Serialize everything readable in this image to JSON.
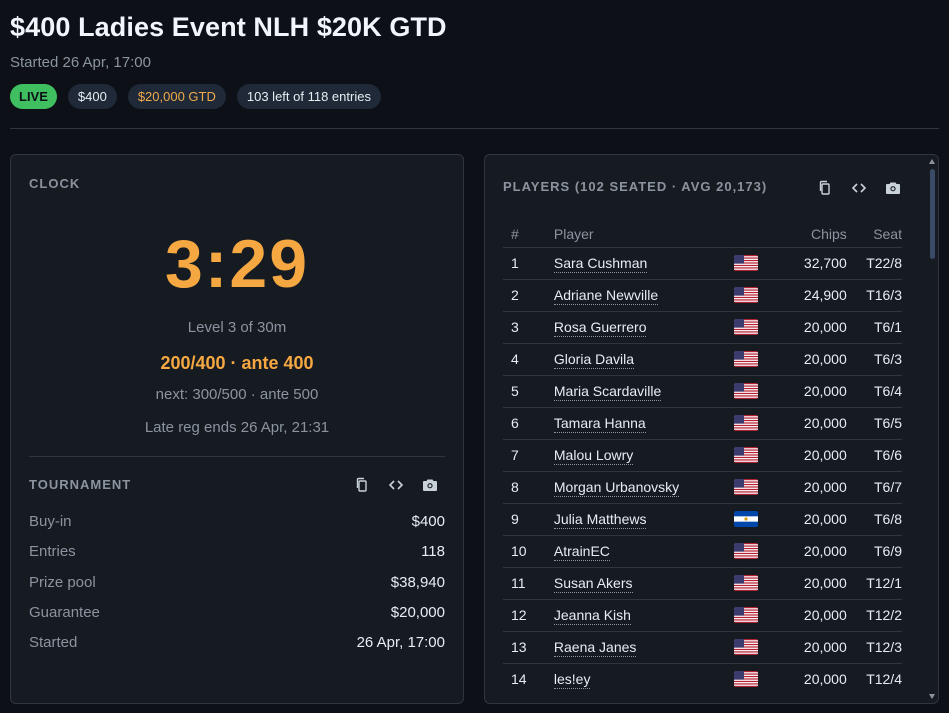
{
  "header": {
    "title": "$400 Ladies Event NLH $20K GTD",
    "started": "Started 26 Apr, 17:00",
    "badges": {
      "live": "LIVE",
      "buyin": "$400",
      "gtd": "$20,000 GTD",
      "entries": "103 left of 118 entries"
    }
  },
  "clock": {
    "label": "CLOCK",
    "time": "3:29",
    "level": "Level 3 of 30m",
    "blinds": "200/400 · ante 400",
    "next": "next: 300/500 · ante 500",
    "late_reg": "Late reg ends 26 Apr, 21:31"
  },
  "tournament": {
    "label": "TOURNAMENT",
    "rows": [
      {
        "k": "Buy-in",
        "v": "$400"
      },
      {
        "k": "Entries",
        "v": "118"
      },
      {
        "k": "Prize pool",
        "v": "$38,940"
      },
      {
        "k": "Guarantee",
        "v": "$20,000"
      },
      {
        "k": "Started",
        "v": "26 Apr, 17:00"
      }
    ]
  },
  "players": {
    "label": "PLAYERS (102 SEATED · AVG 20,173)",
    "columns": {
      "num": "#",
      "player": "Player",
      "chips": "Chips",
      "seat": "Seat"
    },
    "rows": [
      {
        "num": "1",
        "name": "Sara Cushman",
        "flag": "us-flag-icon",
        "chips": "32,700",
        "seat": "T22/8"
      },
      {
        "num": "2",
        "name": "Adriane Newville",
        "flag": "us-flag-icon",
        "chips": "24,900",
        "seat": "T16/3"
      },
      {
        "num": "3",
        "name": "Rosa Guerrero",
        "flag": "us-flag-icon",
        "chips": "20,000",
        "seat": "T6/1"
      },
      {
        "num": "4",
        "name": "Gloria Davila",
        "flag": "us-flag-icon",
        "chips": "20,000",
        "seat": "T6/3"
      },
      {
        "num": "5",
        "name": "Maria Scardaville",
        "flag": "us-flag-icon",
        "chips": "20,000",
        "seat": "T6/4"
      },
      {
        "num": "6",
        "name": "Tamara Hanna",
        "flag": "us-flag-icon",
        "chips": "20,000",
        "seat": "T6/5"
      },
      {
        "num": "7",
        "name": "Malou Lowry",
        "flag": "us-flag-icon",
        "chips": "20,000",
        "seat": "T6/6"
      },
      {
        "num": "8",
        "name": "Morgan Urbanovsky",
        "flag": "us-flag-icon",
        "chips": "20,000",
        "seat": "T6/7"
      },
      {
        "num": "9",
        "name": "Julia Matthews",
        "flag": "sv-flag-icon",
        "chips": "20,000",
        "seat": "T6/8"
      },
      {
        "num": "10",
        "name": "AtrainEC",
        "flag": "us-flag-icon",
        "chips": "20,000",
        "seat": "T6/9"
      },
      {
        "num": "11",
        "name": "Susan Akers",
        "flag": "us-flag-icon",
        "chips": "20,000",
        "seat": "T12/1"
      },
      {
        "num": "12",
        "name": "Jeanna Kish",
        "flag": "us-flag-icon",
        "chips": "20,000",
        "seat": "T12/2"
      },
      {
        "num": "13",
        "name": "Raena Janes",
        "flag": "us-flag-icon",
        "chips": "20,000",
        "seat": "T12/3"
      },
      {
        "num": "14",
        "name": "les!ey",
        "flag": "us-flag-icon",
        "chips": "20,000",
        "seat": "T12/4"
      }
    ]
  },
  "tools": [
    "copy-icon",
    "code-icon",
    "camera-icon"
  ],
  "colors": {
    "accent": "#f5a742",
    "live": "#3fbf5f",
    "bg": "#0d1117",
    "panel": "#161b22"
  }
}
